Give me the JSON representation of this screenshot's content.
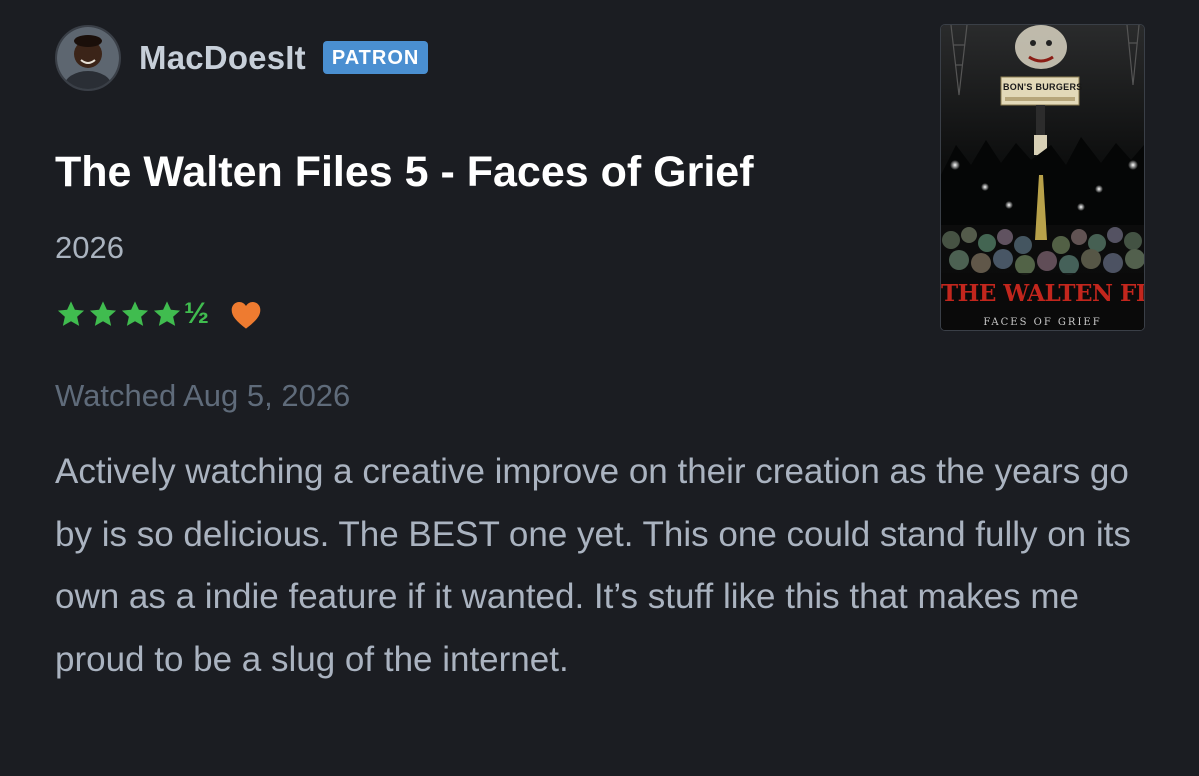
{
  "author": {
    "username": "MacDoesIt",
    "badge": "PATRON",
    "badge_color": "#4a8fd1"
  },
  "film": {
    "title": "The Walten Files 5 - Faces of Grief",
    "year": "2026",
    "poster": {
      "title_text": "THE WALTEN FILES",
      "subtitle_text": "FACES OF GRIEF",
      "sign_text": "BON'S BURGERS"
    }
  },
  "rating": {
    "stars": 4.5,
    "half_symbol": "½",
    "liked": true,
    "star_color": "#40bc4f",
    "heart_color": "#ee7b30",
    "icons": [
      "star-icon",
      "heart-icon"
    ]
  },
  "watched": {
    "label": "Watched Aug 5, 2026"
  },
  "review": {
    "text": "Actively watching a creative improve on their creation as the years go by is so delicious. The BEST one yet. This one could stand fully on its own as a indie feature if it wanted. It’s stuff like this that makes me proud to be a slug of the internet."
  }
}
